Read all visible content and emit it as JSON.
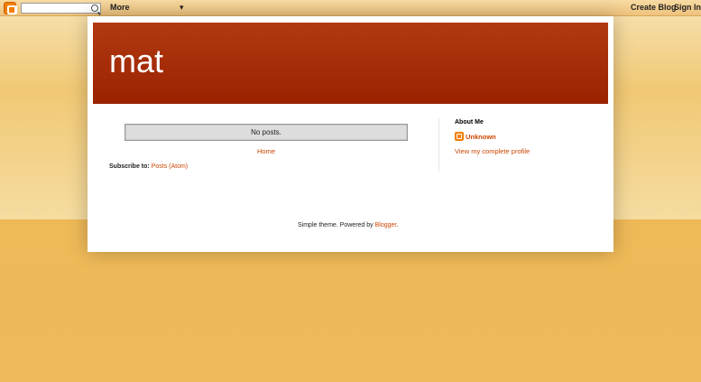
{
  "navbar": {
    "more_label": "More",
    "chevron": "▾",
    "create_blog": "Create Blog",
    "sign_in": "Sign In",
    "search_placeholder": ""
  },
  "header": {
    "title": "mat"
  },
  "main": {
    "no_posts": "No posts.",
    "home_link": "Home",
    "subscribe_label": "Subscribe to: ",
    "subscribe_link": "Posts (Atom)"
  },
  "sidebar": {
    "about_heading": "About Me",
    "profile_name": "Unknown",
    "profile_link": "View my complete profile"
  },
  "footer": {
    "text": "Simple theme. Powered by ",
    "link": "Blogger",
    "suffix": "."
  },
  "colors": {
    "accent": "#cc4400",
    "header_bg": "#a82d08",
    "page_bg": "#eeb957",
    "blogger_orange": "#f57d00"
  }
}
